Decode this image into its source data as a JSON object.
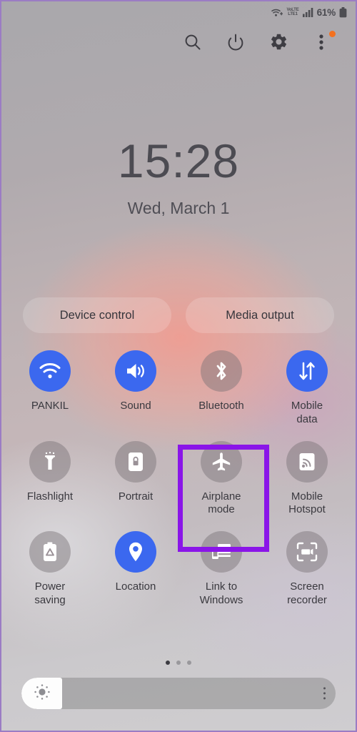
{
  "status_bar": {
    "wifi_icon": "wifi-plus-icon",
    "volte_label_top": "VoLTE",
    "volte_label_bottom": "LTE1",
    "signal_icon": "cellular-signal-icon",
    "battery_percent": "61%",
    "battery_icon": "battery-icon"
  },
  "toolbar": {
    "search_icon": "search-icon",
    "power_icon": "power-icon",
    "settings_icon": "gear-icon",
    "more_icon": "three-dot-menu-icon",
    "notification_dot_color": "#f4711f"
  },
  "clock": {
    "time": "15:28",
    "date": "Wed, March 1"
  },
  "pills": [
    {
      "label": "Device control"
    },
    {
      "label": "Media output"
    }
  ],
  "tiles": [
    {
      "label": "PANKIL",
      "icon": "wifi-icon",
      "state": "on"
    },
    {
      "label": "Sound",
      "icon": "speaker-icon",
      "state": "on"
    },
    {
      "label": "Bluetooth",
      "icon": "bluetooth-icon",
      "state": "off"
    },
    {
      "label": "Mobile\ndata",
      "icon": "data-arrows-icon",
      "state": "on"
    },
    {
      "label": "Flashlight",
      "icon": "flashlight-icon",
      "state": "off"
    },
    {
      "label": "Portrait",
      "icon": "rotation-lock-icon",
      "state": "off"
    },
    {
      "label": "Airplane\nmode",
      "icon": "airplane-icon",
      "state": "off"
    },
    {
      "label": "Mobile\nHotspot",
      "icon": "hotspot-icon",
      "state": "off"
    },
    {
      "label": "Power\nsaving",
      "icon": "power-saving-icon",
      "state": "off"
    },
    {
      "label": "Location",
      "icon": "location-pin-icon",
      "state": "on"
    },
    {
      "label": "Link to\nWindows",
      "icon": "link-to-windows-icon",
      "state": "off"
    },
    {
      "label": "Screen recorder",
      "icon": "screen-recorder-icon",
      "state": "off"
    }
  ],
  "highlight": {
    "target_tile": "Airplane mode",
    "color": "#8a15e8"
  },
  "page_indicator": {
    "total": 3,
    "active": 1
  },
  "brightness": {
    "icon": "brightness-sun-icon",
    "level_percent": 13,
    "menu_icon": "three-dot-menu-icon"
  },
  "theme": {
    "active_tile_color": "#3b68ef",
    "inactive_tile_color": "#787076",
    "text_color": "#3a393f",
    "frame_border_color": "#9b7cc4"
  }
}
